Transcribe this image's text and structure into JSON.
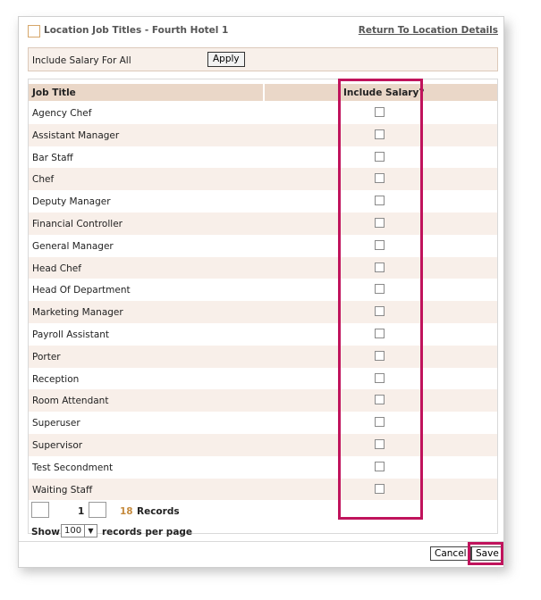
{
  "header": {
    "title": "Location Job Titles - Fourth Hotel 1",
    "return_link": "Return To Location Details"
  },
  "salary_bar": {
    "label": "Include Salary For All",
    "apply_label": "Apply"
  },
  "grid": {
    "col_job_title": "Job Title",
    "col_include_salary": "Include Salary?",
    "rows": [
      {
        "label": "Agency Chef",
        "checked": false
      },
      {
        "label": "Assistant Manager",
        "checked": false
      },
      {
        "label": "Bar Staff",
        "checked": false
      },
      {
        "label": "Chef",
        "checked": false
      },
      {
        "label": "Deputy Manager",
        "checked": false
      },
      {
        "label": "Financial Controller",
        "checked": false
      },
      {
        "label": "General Manager",
        "checked": false
      },
      {
        "label": "Head Chef",
        "checked": false
      },
      {
        "label": "Head Of Department",
        "checked": false
      },
      {
        "label": "Marketing Manager",
        "checked": false
      },
      {
        "label": "Payroll Assistant",
        "checked": false
      },
      {
        "label": "Porter",
        "checked": false
      },
      {
        "label": "Reception",
        "checked": false
      },
      {
        "label": "Room Attendant",
        "checked": false
      },
      {
        "label": "Superuser",
        "checked": false
      },
      {
        "label": "Supervisor",
        "checked": false
      },
      {
        "label": "Test Secondment",
        "checked": false
      },
      {
        "label": "Waiting Staff",
        "checked": false
      }
    ]
  },
  "pager": {
    "page": "1",
    "total": "18",
    "records_label": "Records",
    "show_label": "Show",
    "per_page": "100",
    "per_page_suffix": "records per page"
  },
  "footer": {
    "cancel_label": "Cancel",
    "save_label": "Save"
  },
  "colors": {
    "highlight": "#c0135c",
    "header_bg": "#ead7c8",
    "alt_row_bg": "#f8efe9",
    "total_count": "#c58a3d"
  }
}
